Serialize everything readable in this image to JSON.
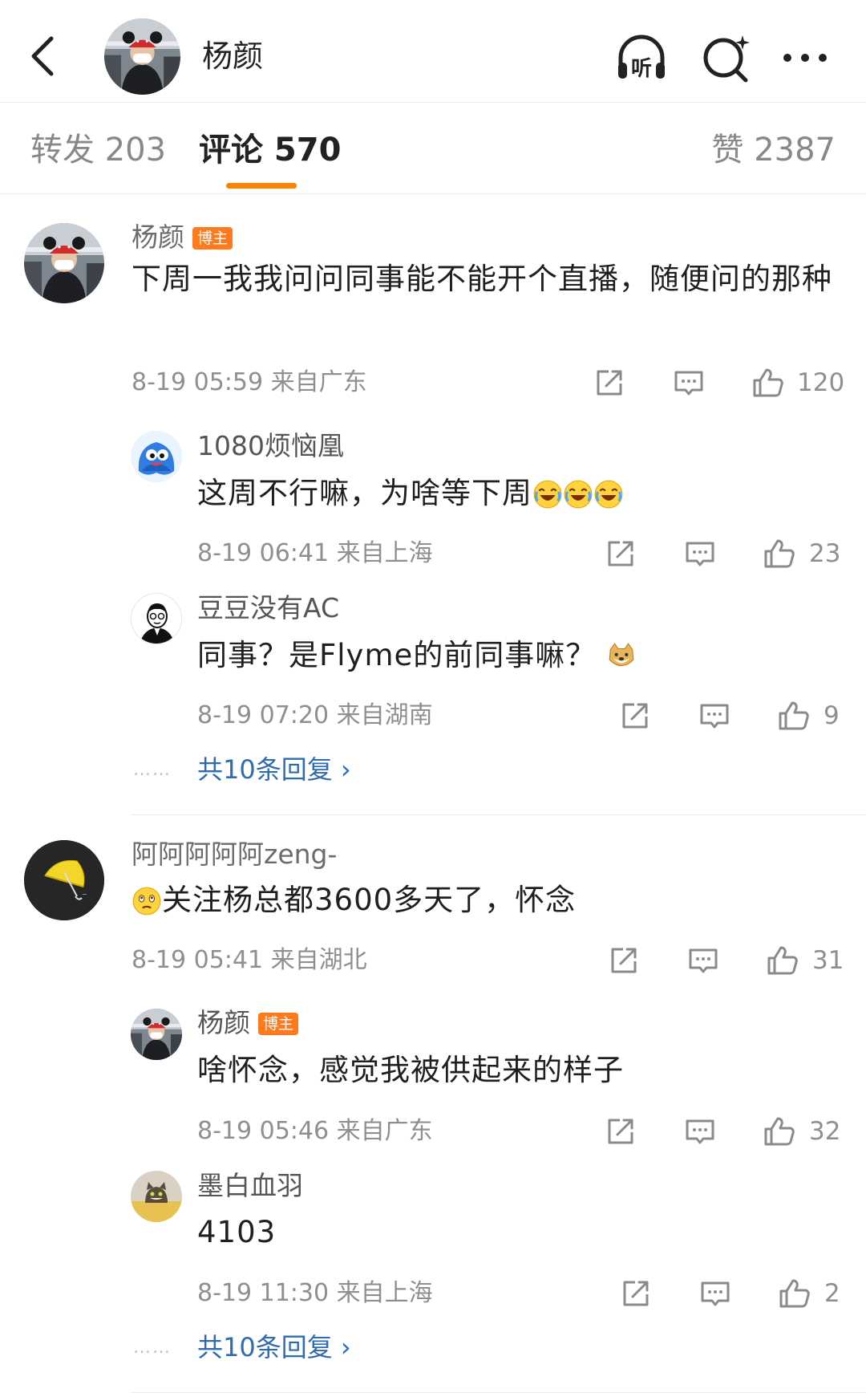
{
  "header": {
    "name": "杨颜",
    "listen_label": "听"
  },
  "tabs": {
    "repost": "转发 203",
    "comment": "评论 570",
    "like": "赞 2387"
  },
  "comments": [
    {
      "user": "杨颜",
      "badge": "博主",
      "text": "下周一我我问问同事能不能开个直播，随便问的那种",
      "meta": "8-19 05:59  来自广东",
      "likes": "120",
      "replies": [
        {
          "user": "1080烦恼凰",
          "text": "这周不行嘛，为啥等下周",
          "meta": "8-19 06:41  来自上海",
          "likes": "23"
        },
        {
          "user": "豆豆没有AC",
          "text": "同事？是Flyme的前同事嘛？",
          "meta": "8-19 07:20  来自湖南",
          "likes": "9"
        }
      ],
      "more_replies": "共10条回复 ›"
    },
    {
      "user": "阿阿阿阿阿zeng-",
      "text": "关注杨总都3600多天了，怀念",
      "meta": "8-19 05:41  来自湖北",
      "likes": "31",
      "replies": [
        {
          "user": "杨颜",
          "badge": "博主",
          "text": "啥怀念，感觉我被供起来的样子",
          "meta": "8-19 05:46  来自广东",
          "likes": "32"
        },
        {
          "user": "墨白血羽",
          "text": "4103",
          "meta": "8-19 11:30  来自上海",
          "likes": "2"
        }
      ],
      "more_replies": "共10条回复 ›"
    }
  ],
  "dots": "……",
  "colors": {
    "accent": "#ff8200",
    "badge": "#ff7a1c",
    "link": "#2f6bb0",
    "secondary_text": "#8f8f8f"
  }
}
